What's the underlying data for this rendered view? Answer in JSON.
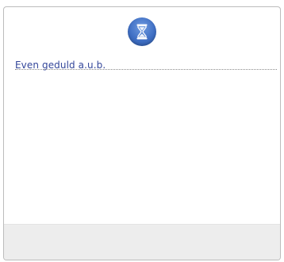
{
  "dialog": {
    "icon": "hourglass-icon",
    "message": "Even geduld a.u.b."
  },
  "colors": {
    "icon_accent": "#3f6fc4",
    "message_text": "#33469a",
    "footer_bg": "#ededed"
  }
}
